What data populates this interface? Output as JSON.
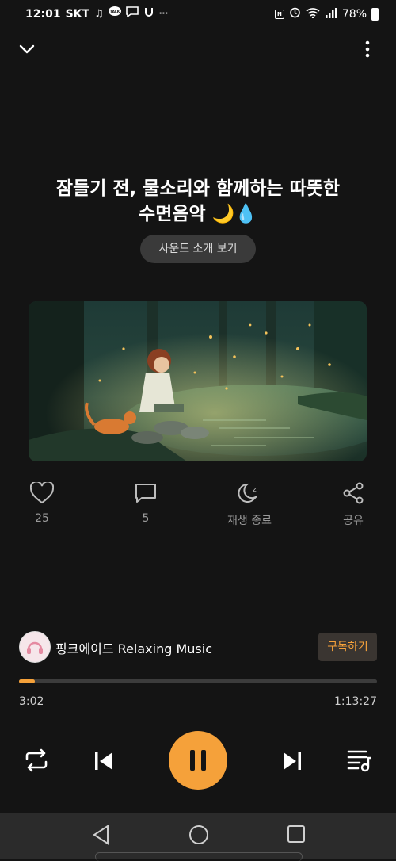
{
  "status_bar": {
    "time": "12:01",
    "carrier": "SKT",
    "battery": "78%"
  },
  "track": {
    "title_line1": "잠들기 전, 물소리와 함께하는 따뜻한",
    "title_line2": "수면음악 🌙💧",
    "intro_button": "사운드 소개 보기"
  },
  "actions": {
    "like_count": "25",
    "comment_count": "5",
    "sleep_timer_label": "재생 종료",
    "share_label": "공유"
  },
  "channel": {
    "name": "핑크에이드 Relaxing Music",
    "subscribe_label": "구독하기"
  },
  "player": {
    "current_time": "3:02",
    "total_time": "1:13:27",
    "progress_fraction": 0.045
  },
  "colors": {
    "accent": "#f5a13a",
    "background": "#141414"
  }
}
